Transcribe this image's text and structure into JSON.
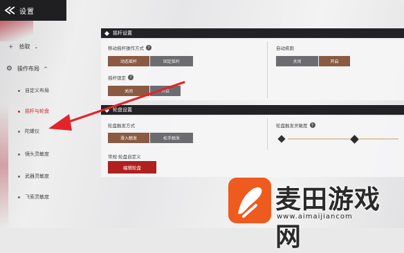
{
  "header": {
    "title": "设置"
  },
  "sidebar": {
    "groups": [
      {
        "label": "拾取"
      },
      {
        "label": "操作布局"
      }
    ],
    "items": [
      {
        "label": "自定义布局"
      },
      {
        "label": "摇杆与轮盘"
      },
      {
        "label": "陀螺仪"
      },
      {
        "label": "镜头灵敏度"
      },
      {
        "label": "武器灵敏度"
      },
      {
        "label": "飞索灵敏度"
      }
    ]
  },
  "joystick": {
    "title": "摇杆设置",
    "move_mode": {
      "label": "移动摇杆操作方式",
      "options": [
        "动态摇杆",
        "固定摇杆"
      ],
      "selected": "动态摇杆"
    },
    "auto_sprint": {
      "label": "自动疾跑",
      "options": [
        "关闭",
        "开启"
      ],
      "selected": "开启"
    },
    "lock": {
      "label": "摇杆锁定",
      "options": [
        "关闭",
        "开启"
      ],
      "selected": "关闭"
    }
  },
  "wheel": {
    "title": "轮盘设置",
    "trigger": {
      "label": "轮盘触发方式",
      "options": [
        "滑入触发",
        "松手触发"
      ],
      "selected": "滑入触发"
    },
    "sensitivity": {
      "label": "轮盘触发灵敏度",
      "value_fraction": 0.6
    },
    "custom": {
      "label": "常规·轮盘自定义",
      "button": "编辑轮盘"
    }
  },
  "watermark": {
    "text": "麦田游戏网",
    "url": "www.aimaijiancom"
  },
  "colors": {
    "accent": "#b0201f",
    "selected": "#8a5a42",
    "header": "#222226"
  }
}
